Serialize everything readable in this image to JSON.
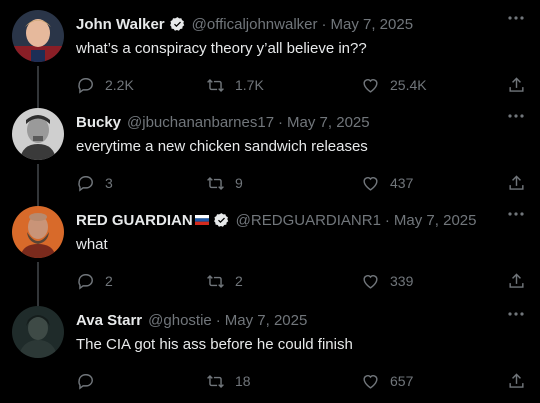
{
  "tweets": [
    {
      "name": "John Walker",
      "verified": true,
      "flag": "",
      "handle": "@officaljohnwalker",
      "date": "May 7, 2025",
      "text": "what’s a conspiracy theory y’all believe in??",
      "replies": "2.2K",
      "retweets": "1.7K",
      "likes": "25.4K"
    },
    {
      "name": "Bucky",
      "verified": false,
      "flag": "",
      "handle": "@jbuchananbarnes17",
      "date": "May 7, 2025",
      "text": "everytime a new chicken sandwich releases",
      "replies": "3",
      "retweets": "9",
      "likes": "437"
    },
    {
      "name": "RED GUARDIAN",
      "verified": true,
      "flag": "russia-flag",
      "handle": "@REDGUARDIANR1",
      "date": "May 7, 2025",
      "text": "what",
      "replies": "2",
      "retweets": "2",
      "likes": "339"
    },
    {
      "name": "Ava Starr",
      "verified": false,
      "flag": "",
      "handle": "@ghostie",
      "date": "May 7, 2025",
      "text": "The CIA got his ass before he could finish",
      "replies": "",
      "retweets": "18",
      "likes": "657"
    }
  ],
  "separator": "·",
  "icons": {
    "reply": "reply-icon",
    "retweet": "retweet-icon",
    "like": "heart-icon",
    "share": "share-icon",
    "more": "more-icon",
    "verified": "verified-badge-icon"
  },
  "colors": {
    "background": "#000000",
    "text": "#e7e9ea",
    "muted": "#71767b",
    "line": "#333639"
  }
}
